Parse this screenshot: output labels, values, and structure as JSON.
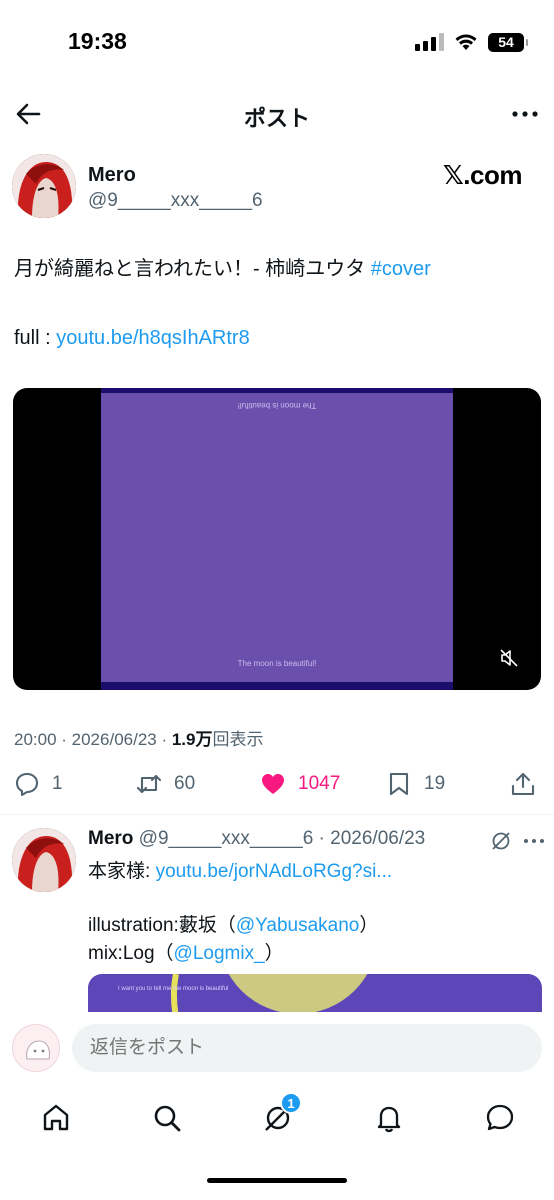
{
  "status_bar": {
    "time": "19:38",
    "battery": "54"
  },
  "header": {
    "title": "ポスト"
  },
  "post": {
    "author_name": "Mero",
    "author_handle": "@9_____xxx_____6",
    "brand": "𝕏.com",
    "text_main": "月が綺麗ねと言われたい！- 柿崎ユウタ ",
    "hashtag": "#cover",
    "link_prefix": "full : ",
    "link": "youtu.be/h8qsIhARtr8",
    "video_caption_top": "The moon is beautiful!",
    "video_caption_bottom": "The moon is beautiful!",
    "time": "20:00 · 2026/06/23 · ",
    "views_count": "1.9万",
    "views_label": "回表示"
  },
  "actions": {
    "reply_count": "1",
    "retweet_count": "60",
    "like_count": "1047",
    "bookmark_count": "19",
    "like_color": "#f91880"
  },
  "reply": {
    "author_name": "Mero",
    "author_handle": " @9_____xxx_____6 · 2026/06/23",
    "line1_prefix": "本家様: ",
    "line1_link": "youtu.be/jorNAdLoRGg?si...",
    "line2_prefix": "illustration:藪坂（",
    "line2_link": "@Yabusakano",
    "line2_suffix": "）",
    "line3_prefix": "mix:Log（",
    "line3_link": "@Logmix_",
    "line3_suffix": "）",
    "media_text": "I want you to tell me the moon is beautiful"
  },
  "composer": {
    "placeholder": "返信をポスト"
  },
  "tabbar": {
    "messages_badge": "1"
  },
  "colors": {
    "accent": "#1d9bf0",
    "video_bg": "#6a4fac",
    "like": "#f91880"
  }
}
